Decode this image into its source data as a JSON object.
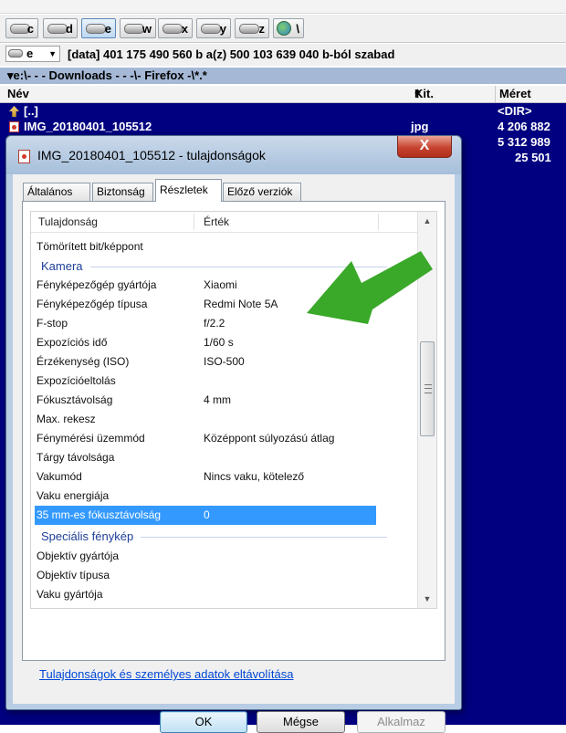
{
  "drives": [
    {
      "label": "c",
      "active": false,
      "icon": "drive-icon"
    },
    {
      "label": "d",
      "active": false,
      "icon": "drive-icon"
    },
    {
      "label": "e",
      "active": true,
      "icon": "drive-icon"
    },
    {
      "label": "w",
      "active": false,
      "icon": "drive-icon"
    },
    {
      "label": "x",
      "active": false,
      "icon": "drive-icon"
    },
    {
      "label": "y",
      "active": false,
      "icon": "drive-icon"
    },
    {
      "label": "z",
      "active": false,
      "icon": "drive-icon"
    },
    {
      "label": "\\",
      "active": false,
      "icon": "network-icon"
    }
  ],
  "drive_select": {
    "value": "e"
  },
  "drive_info": "[data]  401 175 490 560 b a(z) 500 103 639 040 b-ból szabad",
  "current_path": "▾e:\\- - - Downloads - - -\\- Firefox -\\*.*",
  "columns": {
    "name": "Név",
    "ext": "Kit.",
    "size": "Méret"
  },
  "files": [
    {
      "name": "[..]",
      "ext": "",
      "size": "<DIR>",
      "icon": "up-dir-icon"
    },
    {
      "name": "IMG_20180401_105512",
      "ext": "jpg",
      "size": "4 206 882",
      "icon": "image-file-icon"
    },
    {
      "name": "",
      "ext": "",
      "size": "5 312 989",
      "icon": ""
    },
    {
      "name": "",
      "ext": "",
      "size": "25 501",
      "icon": ""
    }
  ],
  "dialog": {
    "title": "IMG_20180401_105512 - tulajdonságok",
    "close_label": "X",
    "tabs": [
      {
        "label": "Általános",
        "active": false
      },
      {
        "label": "Biztonság",
        "active": false
      },
      {
        "label": "Részletek",
        "active": true
      },
      {
        "label": "Előző verziók",
        "active": false
      }
    ],
    "header": {
      "property": "Tulajdonság",
      "value": "Érték"
    },
    "rows": [
      {
        "type": "row",
        "key": "Tömörített bit/képpont",
        "value": ""
      },
      {
        "type": "group",
        "key": "Kamera"
      },
      {
        "type": "row",
        "key": "Fényképezőgép gyártója",
        "value": "Xiaomi"
      },
      {
        "type": "row",
        "key": "Fényképezőgép típusa",
        "value": "Redmi Note 5A"
      },
      {
        "type": "row",
        "key": "F-stop",
        "value": "f/2.2"
      },
      {
        "type": "row",
        "key": "Expozíciós idő",
        "value": "1/60 s"
      },
      {
        "type": "row",
        "key": "Érzékenység (ISO)",
        "value": "ISO-500"
      },
      {
        "type": "row",
        "key": "Expozícióeltolás",
        "value": ""
      },
      {
        "type": "row",
        "key": "Fókusztávolság",
        "value": "4 mm"
      },
      {
        "type": "row",
        "key": "Max. rekesz",
        "value": ""
      },
      {
        "type": "row",
        "key": "Fénymérési üzemmód",
        "value": "Középpont súlyozású átlag"
      },
      {
        "type": "row",
        "key": "Tárgy távolsága",
        "value": ""
      },
      {
        "type": "row",
        "key": "Vakumód",
        "value": "Nincs vaku, kötelező"
      },
      {
        "type": "row",
        "key": "Vaku energiája",
        "value": ""
      },
      {
        "type": "row",
        "key": "35 mm-es fókusztávolság",
        "value": "0",
        "selected": true
      },
      {
        "type": "group",
        "key": "Speciális fénykép"
      },
      {
        "type": "row",
        "key": "Objektív gyártója",
        "value": ""
      },
      {
        "type": "row",
        "key": "Objektív típusa",
        "value": ""
      },
      {
        "type": "row",
        "key": "Vaku gyártója",
        "value": ""
      }
    ],
    "remove_link": "Tulajdonságok és személyes adatok eltávolítása",
    "buttons": {
      "ok": "OK",
      "cancel": "Mégse",
      "apply": "Alkalmaz"
    }
  },
  "colors": {
    "list_bg": "#000080",
    "selection": "#3399ff",
    "arrow": "#3aa829",
    "link": "#0046d5"
  }
}
